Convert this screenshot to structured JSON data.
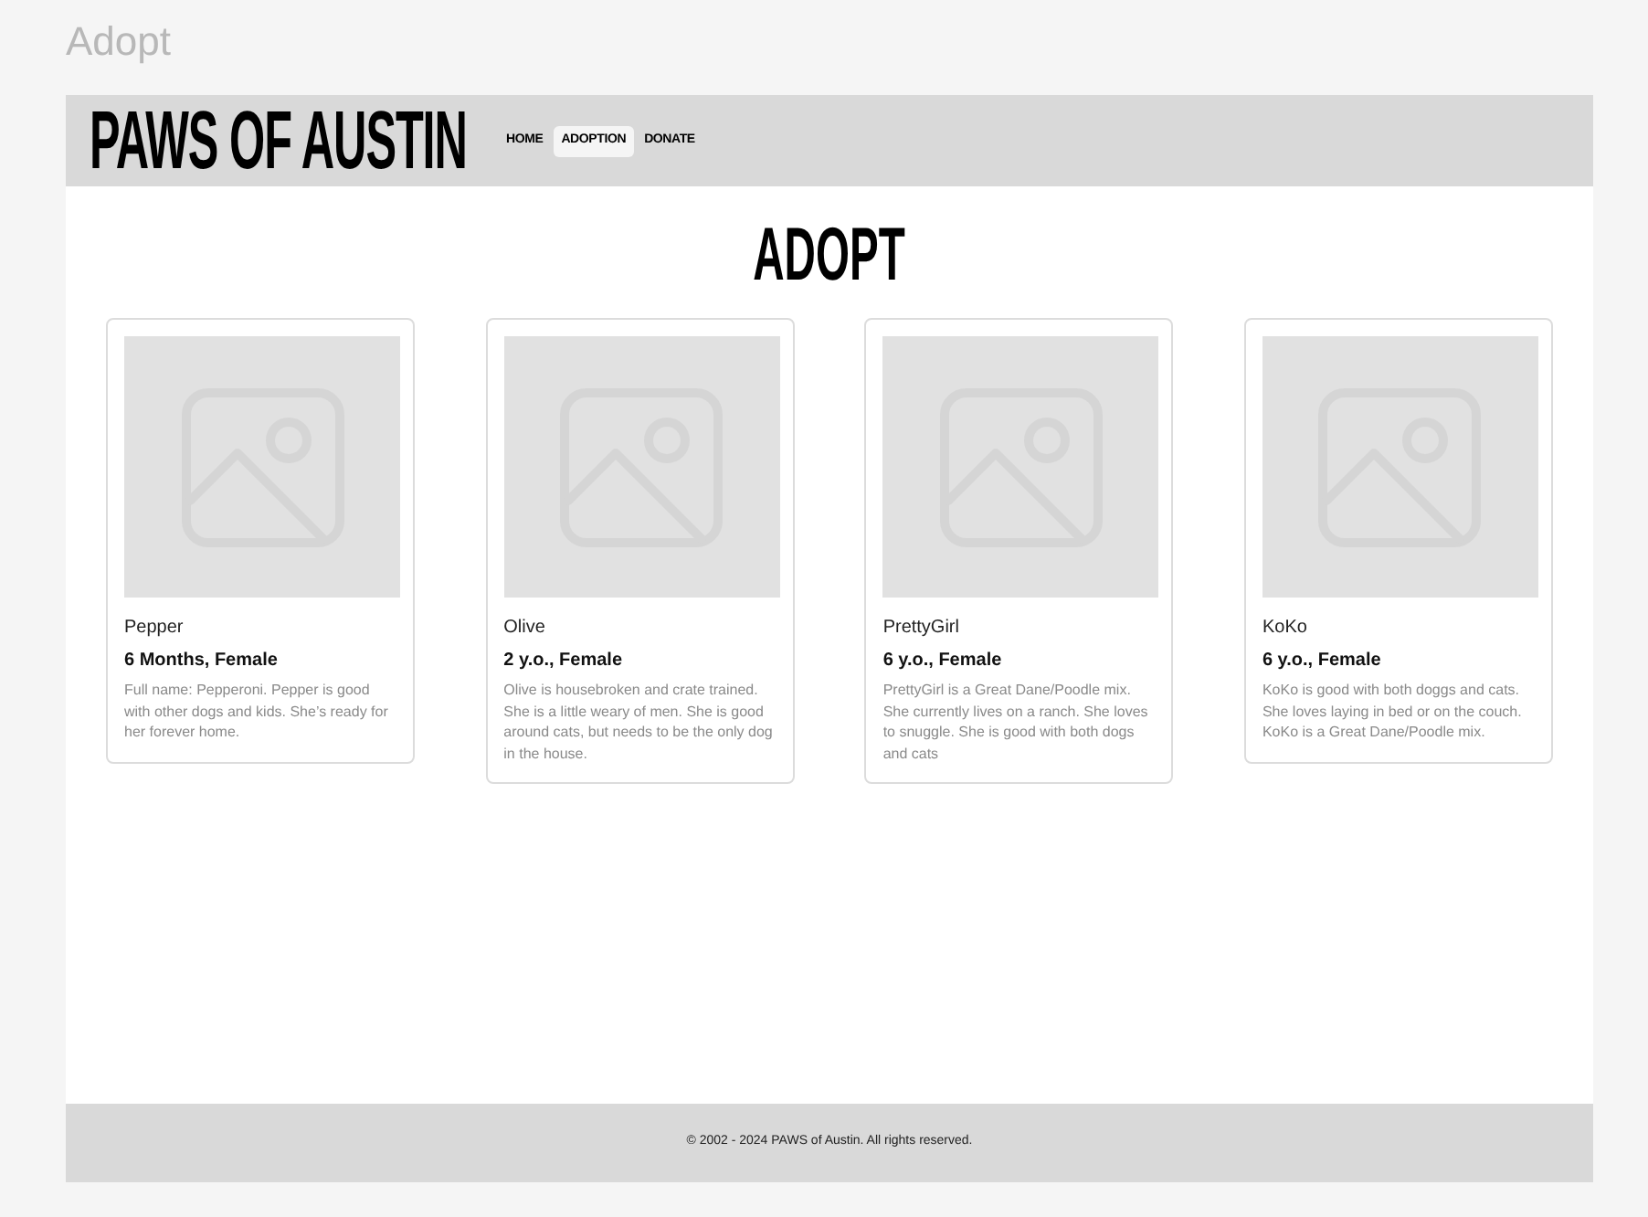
{
  "page_label": "Adopt",
  "header": {
    "logo": "PAWS OF AUSTIN",
    "nav": [
      {
        "label": "HOME",
        "selected": false
      },
      {
        "label": "ADOPTION",
        "selected": true
      },
      {
        "label": "DONATE",
        "selected": false
      }
    ]
  },
  "main": {
    "title": "ADOPT",
    "pets": [
      {
        "name": "Pepper",
        "details": "6 Months, Female",
        "description": "Full name: Pepperoni. Pepper is good with other dogs and kids. She’s ready for her forever home."
      },
      {
        "name": "Olive",
        "details": "2 y.o., Female",
        "description": "Olive is housebroken and crate trained. She is a little weary of men. She is good around cats, but needs to be the only dog in the house."
      },
      {
        "name": "PrettyGirl",
        "details": "6 y.o., Female",
        "description": "PrettyGirl is a Great Dane/Poodle mix. She currently lives on a ranch. She loves to snuggle. She is good with both dogs and cats"
      },
      {
        "name": "KoKo",
        "details": "6 y.o., Female",
        "description": "KoKo is good with both doggs and cats. She loves laying in bed or on the couch. KoKo is a Great Dane/Poodle mix."
      }
    ]
  },
  "footer": {
    "text": "© 2002 - 2024 PAWS of Austin. All rights reserved."
  }
}
